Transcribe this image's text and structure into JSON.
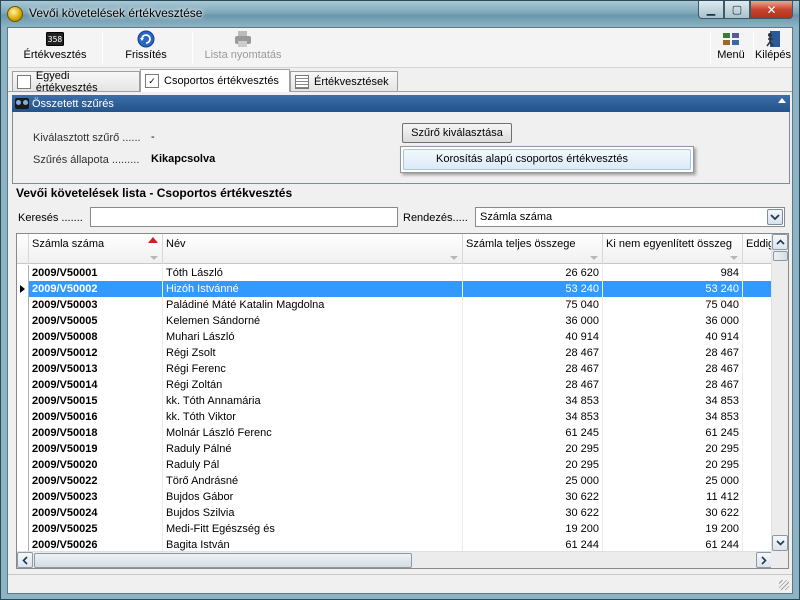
{
  "window": {
    "title": "Vevői követelések értékvesztése"
  },
  "toolbar": {
    "ertekvesztes": "Értékvesztés",
    "frissites": "Frissítés",
    "lista_nyomtatas": "Lista nyomtatás",
    "menu": "Menü",
    "kilepes": "Kilépés",
    "ertekvesztes_icon_text": "358"
  },
  "tabs": [
    {
      "label": "Egyedi értékvesztés",
      "icon": "document-icon"
    },
    {
      "label": "Csoportos értékvesztés",
      "icon": "checkbox-icon"
    },
    {
      "label": "Értékvesztések",
      "icon": "table-icon"
    }
  ],
  "filter": {
    "header": "Összetett szűrés",
    "selected_label": "Kiválasztott szűrő ......",
    "selected_value": "-",
    "state_label": "Szűrés állapota .........",
    "state_value": "Kikapcsolva",
    "choose_button": "Szűrő kiválasztása",
    "popup_item": "Korosítás alapú csoportos értékvesztés"
  },
  "list": {
    "title": "Vevői követelések lista - Csoportos értékvesztés",
    "search_label": "Keresés .......",
    "search_value": "",
    "sort_label": "Rendezés.....",
    "sort_value": "Számla száma"
  },
  "grid": {
    "columns": [
      "Számla száma",
      "Név",
      "Számla teljes összege",
      "Ki nem egyenlített összeg",
      "Eddig é"
    ],
    "selected_row": 1,
    "rows": [
      [
        "2009/V50001",
        "Tóth László",
        "26 620",
        "984"
      ],
      [
        "2009/V50002",
        "Hizóh Istvánné",
        "53 240",
        "53 240"
      ],
      [
        "2009/V50003",
        "Paládiné Máté Katalin Magdolna",
        "75 040",
        "75 040"
      ],
      [
        "2009/V50005",
        "Kelemen Sándorné",
        "36 000",
        "36 000"
      ],
      [
        "2009/V50008",
        "Muhari László",
        "40 914",
        "40 914"
      ],
      [
        "2009/V50012",
        "Régi Zsolt",
        "28 467",
        "28 467"
      ],
      [
        "2009/V50013",
        "Régi Ferenc",
        "28 467",
        "28 467"
      ],
      [
        "2009/V50014",
        "Régi Zoltán",
        "28 467",
        "28 467"
      ],
      [
        "2009/V50015",
        "kk. Tóth Annamária",
        "34 853",
        "34 853"
      ],
      [
        "2009/V50016",
        "kk. Tóth Viktor",
        "34 853",
        "34 853"
      ],
      [
        "2009/V50018",
        "Molnár László Ferenc",
        "61 245",
        "61 245"
      ],
      [
        "2009/V50019",
        "Raduly Pálné",
        "20 295",
        "20 295"
      ],
      [
        "2009/V50020",
        "Raduly Pál",
        "20 295",
        "20 295"
      ],
      [
        "2009/V50022",
        "Törő Andrásné",
        "25 000",
        "25 000"
      ],
      [
        "2009/V50023",
        "Bujdos Gábor",
        "30 622",
        "11 412"
      ],
      [
        "2009/V50024",
        "Bujdos Szilvia",
        "30 622",
        "30 622"
      ],
      [
        "2009/V50025",
        "Medi-Fitt Egészség és",
        "19 200",
        "19 200"
      ],
      [
        "2009/V50026",
        "Bagita István",
        "61 244",
        "61 244"
      ]
    ]
  }
}
